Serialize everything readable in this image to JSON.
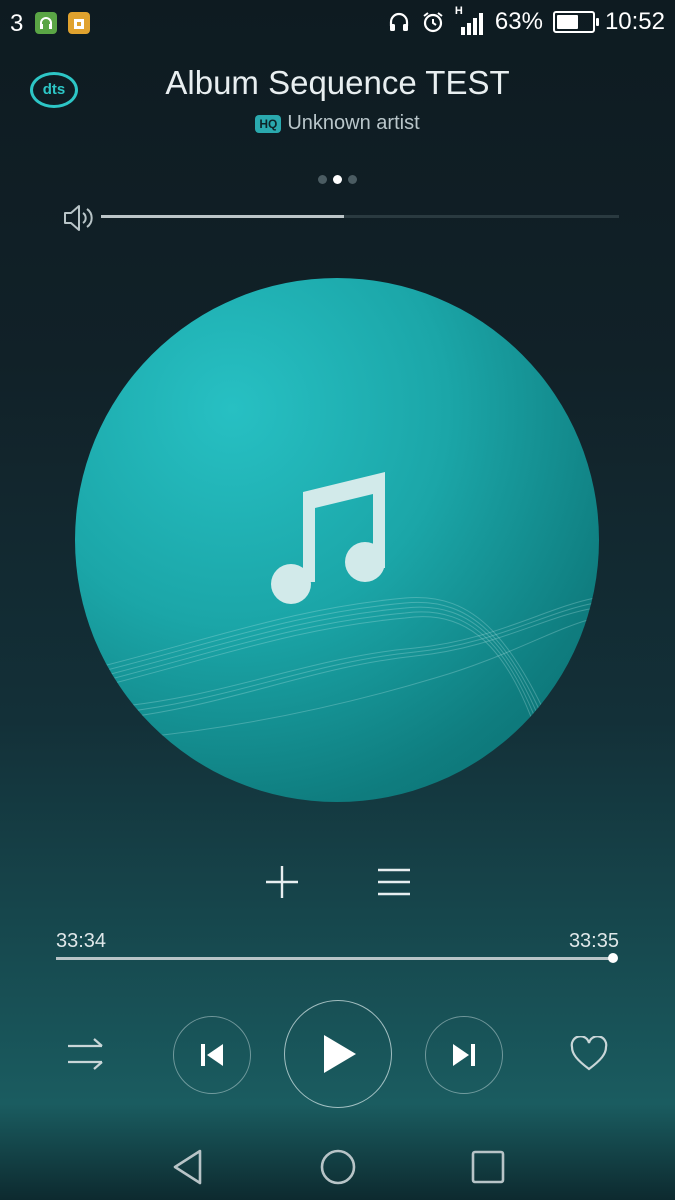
{
  "status_bar": {
    "carrier": "3",
    "battery": "63%",
    "battery_level": 0.63,
    "time": "10:52",
    "network_label": "H",
    "icons": [
      "headset-app-icon",
      "app-store-icon",
      "headphones-icon",
      "alarm-icon",
      "signal-icon",
      "battery-icon"
    ]
  },
  "header": {
    "dts_label": "dts",
    "title": "Album Sequence TEST",
    "quality_badge": "HQ",
    "artist": "Unknown artist",
    "page_count": 3,
    "active_page": 1
  },
  "volume": {
    "level": 0.47
  },
  "album_art": {
    "icon": "music-note-icon"
  },
  "actions": {
    "add": "plus-icon",
    "queue": "menu-icon"
  },
  "progress": {
    "elapsed": "33:34",
    "total": "33:35",
    "fraction": 0.999
  },
  "controls": [
    "shuffle-icon",
    "previous-icon",
    "play-icon",
    "next-icon",
    "heart-icon"
  ],
  "colors": {
    "accent": "#2dc6c6",
    "art_primary": "#1ba6a8",
    "text": "#e8eef0"
  }
}
